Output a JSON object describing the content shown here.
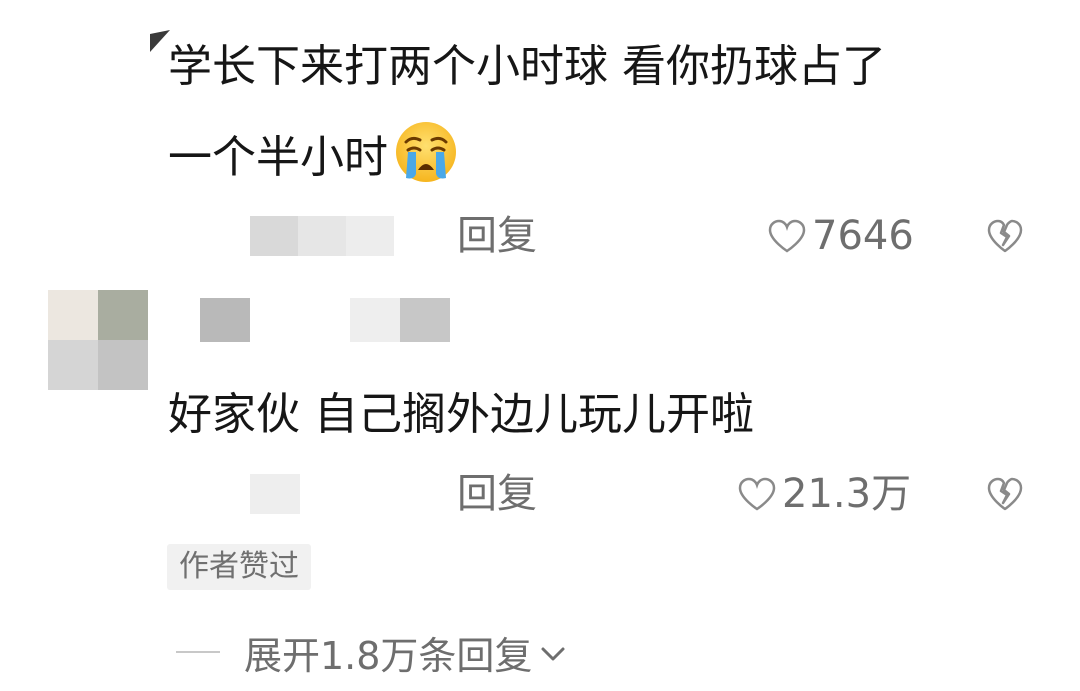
{
  "comment1": {
    "line1": "学长下来打两个小时球 看你扔球占了",
    "line2": "一个半小时",
    "emoji": "loudly-crying-face",
    "reply_label": "回复",
    "like_count": "7646"
  },
  "comment2": {
    "text": "好家伙 自己搁外边儿玩儿开啦",
    "reply_label": "回复",
    "like_count": "21.3万",
    "author_badge": "作者赞过"
  },
  "expand_replies": "展开1.8万条回复",
  "colors": {
    "text_primary": "#161616",
    "text_secondary": "#6e6e6e",
    "badge_bg": "#f1f1f1",
    "background": "#ffffff"
  }
}
